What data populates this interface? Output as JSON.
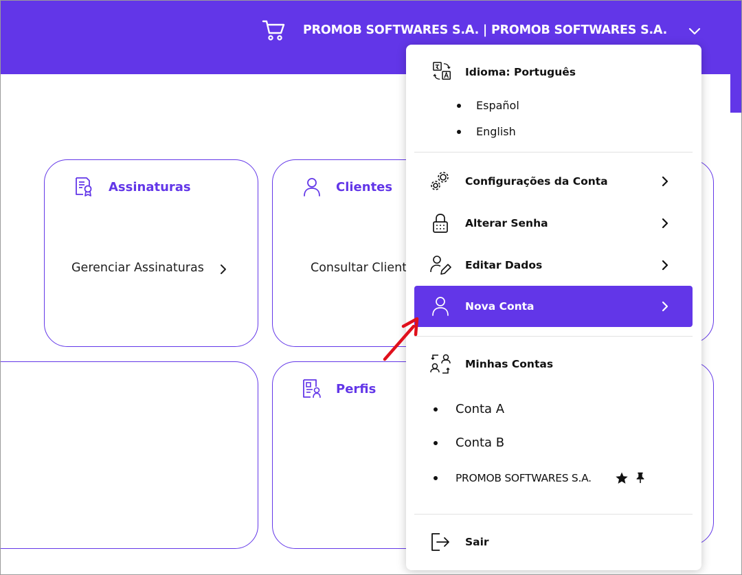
{
  "header": {
    "company_title": "PROMOB SOFTWARES S.A. | PROMOB SOFTWARES S.A.",
    "cart_icon": "cart-icon",
    "expand_icon": "chevron-down-icon"
  },
  "cards": [
    {
      "title": "Assinaturas",
      "link": "Gerenciar Assinaturas",
      "icon": "certificate-document-icon"
    },
    {
      "title": "Clientes",
      "link": "Consultar Clientes",
      "icon": "user-icon"
    },
    {
      "title": "",
      "link": "",
      "icon": ""
    },
    {
      "title": "Perfis",
      "link": "",
      "icon": "profile-card-icon"
    }
  ],
  "menu": {
    "language": {
      "label": "Idioma: Português",
      "icon": "translate-icon",
      "options": [
        "Español",
        "English"
      ]
    },
    "items": [
      {
        "label": "Configurações da Conta",
        "icon": "gears-icon"
      },
      {
        "label": "Alterar Senha",
        "icon": "lock-icon"
      },
      {
        "label": "Editar Dados",
        "icon": "user-edit-icon"
      },
      {
        "label": "Nova Conta",
        "icon": "user-icon",
        "active": true
      }
    ],
    "accounts": {
      "label": "Minhas Contas",
      "icon": "switch-accounts-icon",
      "list": [
        {
          "name": "Conta A"
        },
        {
          "name": "Conta B"
        },
        {
          "name": "PROMOB SOFTWARES S.A.",
          "favorite_icon": "star-icon",
          "pin_icon": "pin-icon"
        }
      ]
    },
    "logout": {
      "label": "Sair",
      "icon": "logout-icon"
    }
  },
  "colors": {
    "brand": "#6236e8",
    "annotation_arrow": "#e0101c"
  }
}
